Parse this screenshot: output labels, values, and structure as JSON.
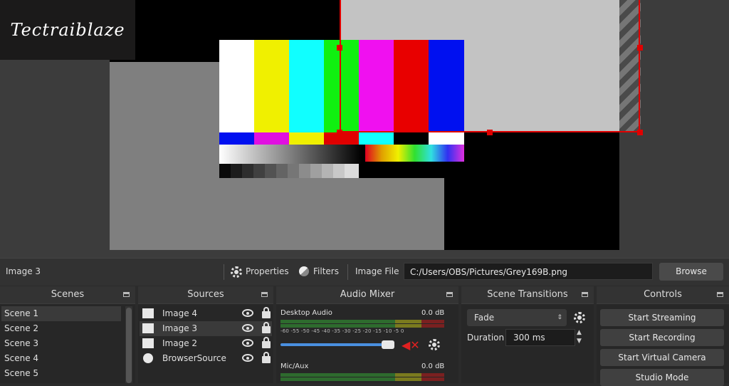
{
  "watermark": "Tectraiblaze",
  "context_bar": {
    "source_name": "Image 3",
    "properties_label": "Properties",
    "filters_label": "Filters",
    "image_file_label": "Image File",
    "image_file_path": "C:/Users/OBS/Pictures/Grey169B.png",
    "browse_label": "Browse"
  },
  "scenes": {
    "title": "Scenes",
    "items": [
      "Scene 1",
      "Scene 2",
      "Scene 3",
      "Scene 4",
      "Scene 5"
    ]
  },
  "sources": {
    "title": "Sources",
    "items": [
      "Image 4",
      "Image 3",
      "Image 2",
      "BrowserSource"
    ]
  },
  "audio_mixer": {
    "title": "Audio Mixer",
    "channels": [
      {
        "name": "Desktop Audio",
        "level": "0.0 dB"
      },
      {
        "name": "Mic/Aux",
        "level": "0.0 dB"
      }
    ],
    "ticks": "-60 -55 -50 -45 -40 -35 -30 -25 -20 -15 -10 -5 0"
  },
  "scene_transitions": {
    "title": "Scene Transitions",
    "transition": "Fade",
    "duration_label": "Duration",
    "duration_value": "300 ms"
  },
  "controls": {
    "title": "Controls",
    "buttons": [
      "Start Streaming",
      "Start Recording",
      "Start Virtual Camera",
      "Studio Mode"
    ]
  },
  "colors": {
    "selection": "#e00000",
    "volume_slider": "#4a90e0"
  }
}
